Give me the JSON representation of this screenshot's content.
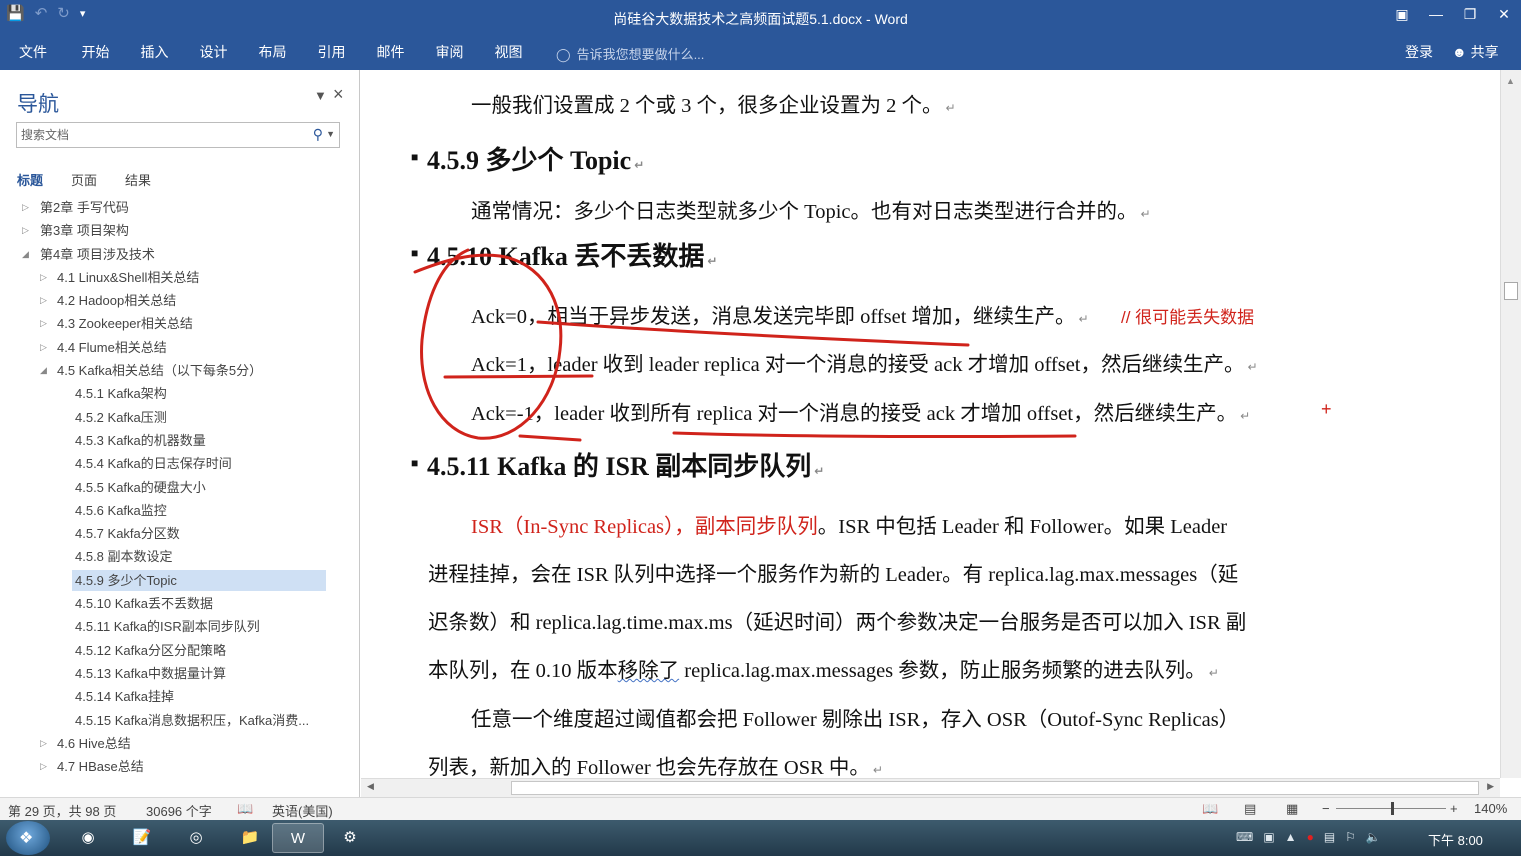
{
  "window": {
    "title": "尚硅谷大数据技术之高频面试题5.1.docx - Word"
  },
  "ribbon": {
    "tabs": [
      "文件",
      "开始",
      "插入",
      "设计",
      "布局",
      "引用",
      "邮件",
      "审阅",
      "视图"
    ],
    "tell_me": "告诉我您想要做什么...",
    "login": "登录",
    "share": "共享"
  },
  "nav": {
    "title": "导航",
    "search_placeholder": "搜索文档",
    "tabs": [
      "标题",
      "页面",
      "结果"
    ],
    "items": [
      {
        "label": "第2章 手写代码",
        "level": 0,
        "state": "collapsed"
      },
      {
        "label": "第3章 项目架构",
        "level": 0,
        "state": "collapsed"
      },
      {
        "label": "第4章 项目涉及技术",
        "level": 0,
        "state": "expanded"
      },
      {
        "label": "4.1 Linux&Shell相关总结",
        "level": 1,
        "state": "collapsed"
      },
      {
        "label": "4.2 Hadoop相关总结",
        "level": 1,
        "state": "collapsed"
      },
      {
        "label": "4.3 Zookeeper相关总结",
        "level": 1,
        "state": "collapsed"
      },
      {
        "label": "4.4 Flume相关总结",
        "level": 1,
        "state": "collapsed"
      },
      {
        "label": "4.5 Kafka相关总结（以下每条5分）",
        "level": 1,
        "state": "expanded"
      },
      {
        "label": "4.5.1 Kafka架构",
        "level": 2,
        "state": "leaf"
      },
      {
        "label": "4.5.2 Kafka压测",
        "level": 2,
        "state": "leaf"
      },
      {
        "label": "4.5.3 Kafka的机器数量",
        "level": 2,
        "state": "leaf"
      },
      {
        "label": "4.5.4 Kafka的日志保存时间",
        "level": 2,
        "state": "leaf"
      },
      {
        "label": "4.5.5 Kafka的硬盘大小",
        "level": 2,
        "state": "leaf"
      },
      {
        "label": "4.5.6 Kafka监控",
        "level": 2,
        "state": "leaf"
      },
      {
        "label": "4.5.7 Kakfa分区数",
        "level": 2,
        "state": "leaf"
      },
      {
        "label": "4.5.8 副本数设定",
        "level": 2,
        "state": "leaf"
      },
      {
        "label": "4.5.9 多少个Topic",
        "level": 2,
        "state": "selected"
      },
      {
        "label": "4.5.10 Kafka丢不丢数据",
        "level": 2,
        "state": "leaf"
      },
      {
        "label": "4.5.11 Kafka的ISR副本同步队列",
        "level": 2,
        "state": "leaf"
      },
      {
        "label": "4.5.12 Kafka分区分配策略",
        "level": 2,
        "state": "leaf"
      },
      {
        "label": "4.5.13 Kafka中数据量计算",
        "level": 2,
        "state": "leaf"
      },
      {
        "label": "4.5.14 Kafka挂掉",
        "level": 2,
        "state": "leaf"
      },
      {
        "label": "4.5.15 Kafka消息数据积压，Kafka消费...",
        "level": 2,
        "state": "leaf"
      },
      {
        "label": "4.6 Hive总结",
        "level": 1,
        "state": "collapsed"
      },
      {
        "label": "4.7 HBase总结",
        "level": 1,
        "state": "collapsed"
      }
    ]
  },
  "doc": {
    "line_top": "一般我们设置成 2 个或 3 个，很多企业设置为 2 个。",
    "h_459": "4.5.9  多少个 Topic",
    "p_459": "通常情况：多少个日志类型就多少个 Topic。也有对日志类型进行合并的。",
    "h_4510": "4.5.10 Kafka 丢不丢数据",
    "ack0": "Ack=0，相当于异步发送，消息发送完毕即 offset 增加，继续生产。",
    "ack0_note": "// 很可能丢失数据",
    "ack1": "Ack=1，leader 收到 leader replica  对一个消息的接受 ack 才增加 offset，然后继续生产。",
    "ackm1": "Ack=-1，leader 收到所有 replica  对一个消息的接受 ack 才增加 offset，然后继续生产。",
    "h_4511": "4.5.11 Kafka 的 ISR 副本同步队列",
    "isr_red": "ISR（In-Sync Replicas），副本同步队列",
    "isr_1_rest": "。ISR 中包括 Leader 和 Follower。如果 Leader",
    "isr_2": "进程挂掉，会在 ISR 队列中选择一个服务作为新的 Leader。有 replica.lag.max.messages（延",
    "isr_3": "迟条数）和 replica.lag.time.max.ms（延迟时间）两个参数决定一台服务是否可以加入 ISR 副",
    "isr_4a": "本队列，在 0.10 版本",
    "isr_4b": "移除了",
    "isr_4c": " replica.lag.max.messages 参数，防止服务频繁的进去队列。",
    "isr_5": "任意一个维度超过阈值都会把 Follower 剔除出 ISR，存入 OSR（Outof-Sync Replicas）",
    "isr_6": "列表，新加入的 Follower 也会先存放在 OSR 中。",
    "para_mark": "↵",
    "plus_mark": "+"
  },
  "status": {
    "page": "第 29 页，共 98 页",
    "words": "30696 个字",
    "lang": "英语(美国)",
    "zoom": "140%"
  },
  "taskbar": {
    "clock": "下午 8:00"
  },
  "colors": {
    "word_blue": "#2b579a",
    "annotation_red": "#d0231b",
    "nav_selected": "#cfe0f4"
  }
}
